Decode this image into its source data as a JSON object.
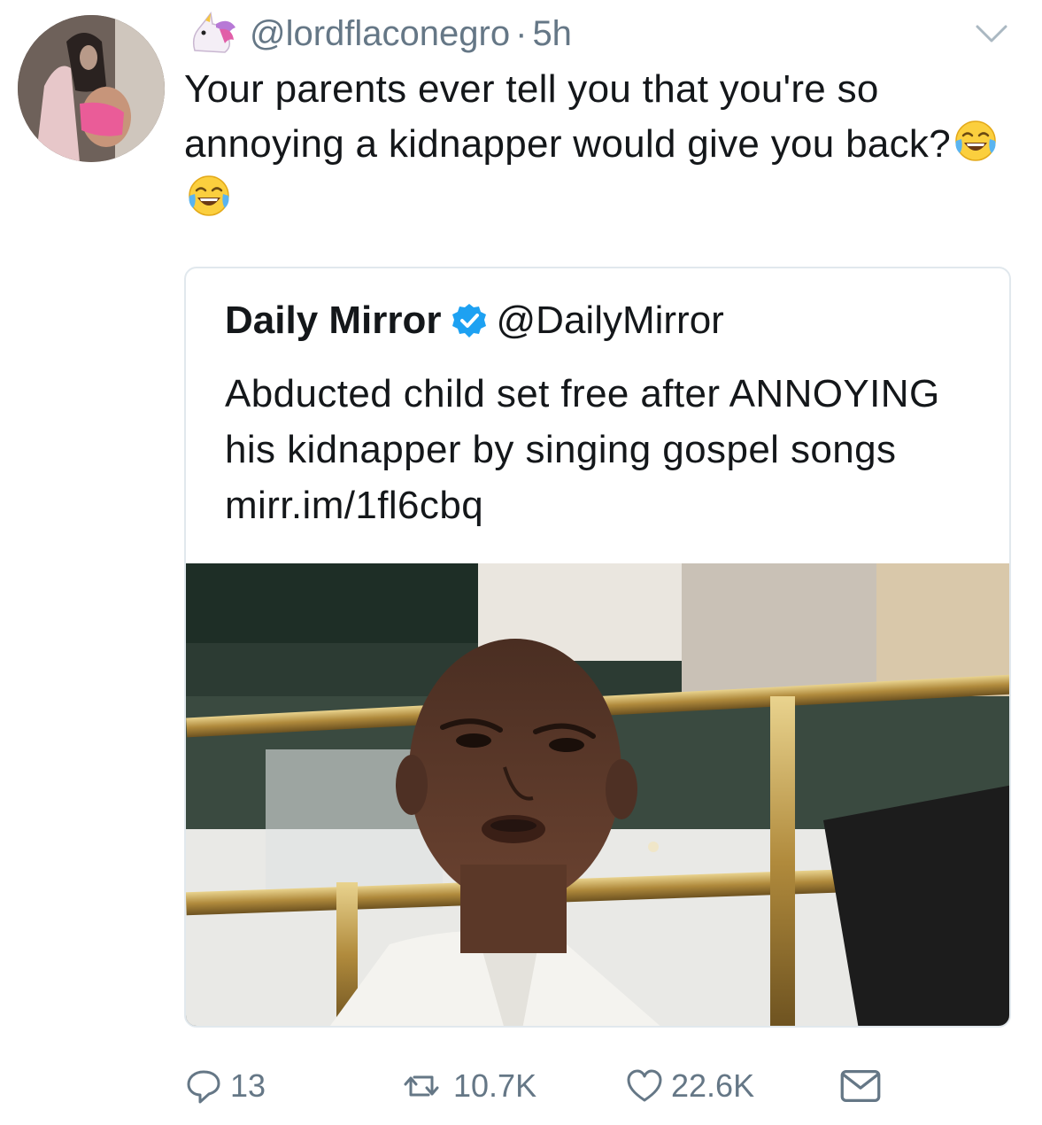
{
  "tweet": {
    "handle": "@lordflaconegro",
    "separator": "·",
    "time": "5h",
    "text": "Your parents ever tell you that you're so annoying a kidnapper would give you back?",
    "icons": {
      "name_emoji": "unicorn-icon",
      "text_emoji": "tears-of-joy-emoji",
      "menu": "chevron-down-icon"
    }
  },
  "quote": {
    "name": "Daily Mirror",
    "handle": "@DailyMirror",
    "text": "Abducted child set free after ANNOYING his kidnapper by singing gospel songs mirr.im/1fl6cbq",
    "verified_icon": "verified-badge-icon"
  },
  "actions": {
    "replies": "13",
    "retweets": "10.7K",
    "likes": "22.6K"
  },
  "colors": {
    "text": "#14171a",
    "muted": "#657786",
    "border": "#e1e8ed",
    "verified": "#1da1f2"
  }
}
